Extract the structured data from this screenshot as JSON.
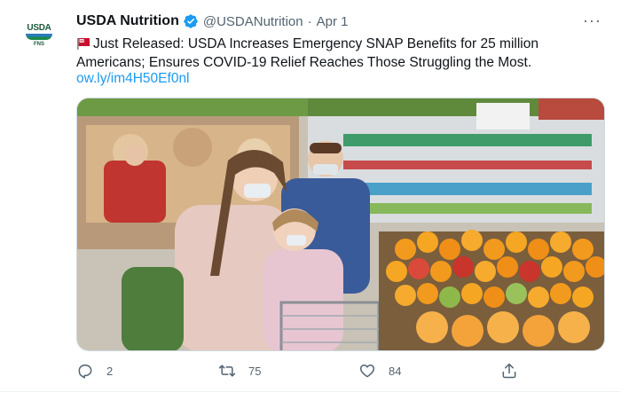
{
  "tweet": {
    "author": {
      "name": "USDA Nutrition",
      "handle": "@USDANutrition",
      "avatar_text_top": "USDA",
      "avatar_text_bottom": "FNS"
    },
    "separator": "·",
    "date": "Apr 1",
    "text": "Just Released: USDA Increases Emergency SNAP Benefits for 25 million Americans; Ensures COVID-19 Relief Reaches Those Struggling the Most.",
    "link": "ow.ly/im4H50Ef0nl",
    "more_label": "···",
    "image_alt": "Family wearing masks shopping for produce in a grocery store",
    "stats": {
      "replies": "2",
      "retweets": "75",
      "likes": "84"
    }
  },
  "colors": {
    "accent": "#1d9bf0",
    "text_secondary": "#536471",
    "verified": "#1d9bf0"
  },
  "icons": [
    "usda-logo-icon",
    "verified-badge-icon",
    "flag-emoji-icon",
    "more-icon",
    "reply-icon",
    "retweet-icon",
    "like-icon",
    "share-icon"
  ]
}
